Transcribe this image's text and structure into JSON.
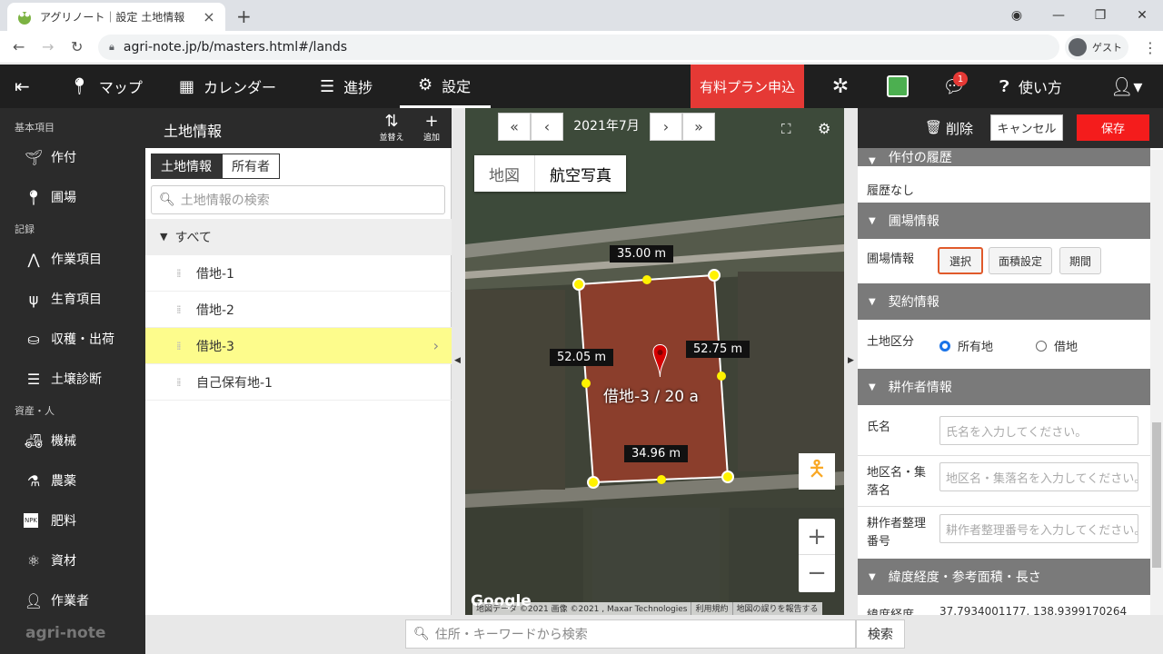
{
  "browser": {
    "tab_title": "アグリノート｜設定 土地情報",
    "url": "agri-note.jp/b/masters.html#/lands",
    "profile": "ゲスト"
  },
  "header": {
    "nav": [
      "マップ",
      "カレンダー",
      "進捗",
      "設定"
    ],
    "plan_button": "有料プラン申込",
    "notification_count": "1",
    "help": "使い方"
  },
  "sidebar": {
    "sections": [
      "基本項目",
      "記録",
      "資産・人"
    ],
    "items": [
      "作付",
      "圃場",
      "作業項目",
      "生育項目",
      "収穫・出荷",
      "土壌診断",
      "機械",
      "農薬",
      "肥料",
      "資材",
      "作業者"
    ],
    "logo": "agri-note",
    "npk_label": "NPK"
  },
  "list": {
    "title": "土地情報",
    "sort_label": "並替え",
    "add_label": "追加",
    "tabs": [
      "土地情報",
      "所有者"
    ],
    "search_placeholder": "土地情報の検索",
    "all_label": "すべて",
    "rows": [
      "借地-1",
      "借地-2",
      "借地-3",
      "自己保有地-1"
    ]
  },
  "map": {
    "month": "2021年7月",
    "type_map": "地図",
    "type_aerial": "航空写真",
    "dims": [
      "35.00 m",
      "52.05 m",
      "52.75 m",
      "34.96 m"
    ],
    "field_label": "借地-3 / 20 a",
    "google": "Google",
    "attribution": [
      "地図データ ©2021 画像 ©2021 , Maxar Technologies",
      "利用規約",
      "地図の誤りを報告する"
    ]
  },
  "panel": {
    "delete": "削除",
    "cancel": "キャンセル",
    "save": "保存",
    "crop_history_header": "作付の履歴",
    "crop_history_value": "履歴なし",
    "field_header": "圃場情報",
    "field_label": "圃場情報",
    "btn_select": "選択",
    "btn_area": "面積設定",
    "btn_period": "期間",
    "contract_header": "契約情報",
    "land_type_label": "土地区分",
    "opt_owned": "所有地",
    "opt_leased": "借地",
    "farmer_header": "耕作者情報",
    "name_label": "氏名",
    "name_placeholder": "氏名を入力してください。",
    "district_label": "地区名・集落名",
    "district_placeholder": "地区名・集落名を入力してください。",
    "farmer_no_label": "耕作者整理番号",
    "farmer_no_placeholder": "耕作者整理番号を入力してください。",
    "latlng_header": "緯度経度・参考面積・長さ",
    "latlng_label": "緯度経度",
    "latlng_value": "37.7934001177, 138.9399170264"
  },
  "bottom": {
    "search_placeholder": "住所・キーワードから検索",
    "search_button": "検索"
  }
}
